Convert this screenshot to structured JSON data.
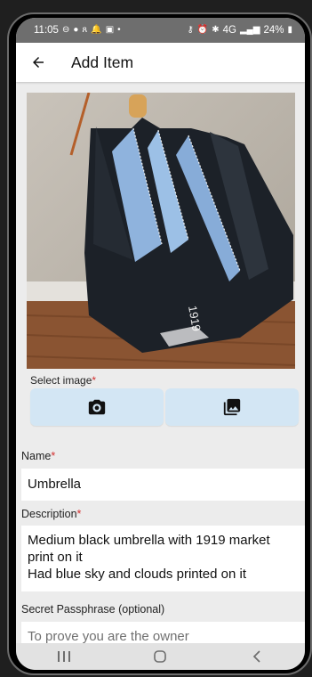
{
  "status_bar": {
    "time": "11:05",
    "battery": "24%",
    "network": "4G"
  },
  "app_bar": {
    "title": "Add Item",
    "back_icon": "arrow-back-icon"
  },
  "photo": {
    "subject": "umbrella"
  },
  "select_image": {
    "label": "Select image",
    "required_mark": "*",
    "camera_icon": "camera-icon",
    "gallery_icon": "gallery-icon"
  },
  "form": {
    "name": {
      "label": "Name",
      "required_mark": "*",
      "value": "Umbrella"
    },
    "description": {
      "label": "Description",
      "required_mark": "*",
      "lines": [
        "Medium black umbrella with 1919 market",
        "print on it",
        "Had blue sky and clouds printed on it"
      ]
    },
    "secret": {
      "label": "Secret Passphrase (optional)",
      "placeholder": "To prove you are the owner"
    }
  },
  "colors": {
    "accent_button": "#d3e6f4",
    "required": "#d32f2f",
    "status_bar": "#6e6e6e"
  }
}
